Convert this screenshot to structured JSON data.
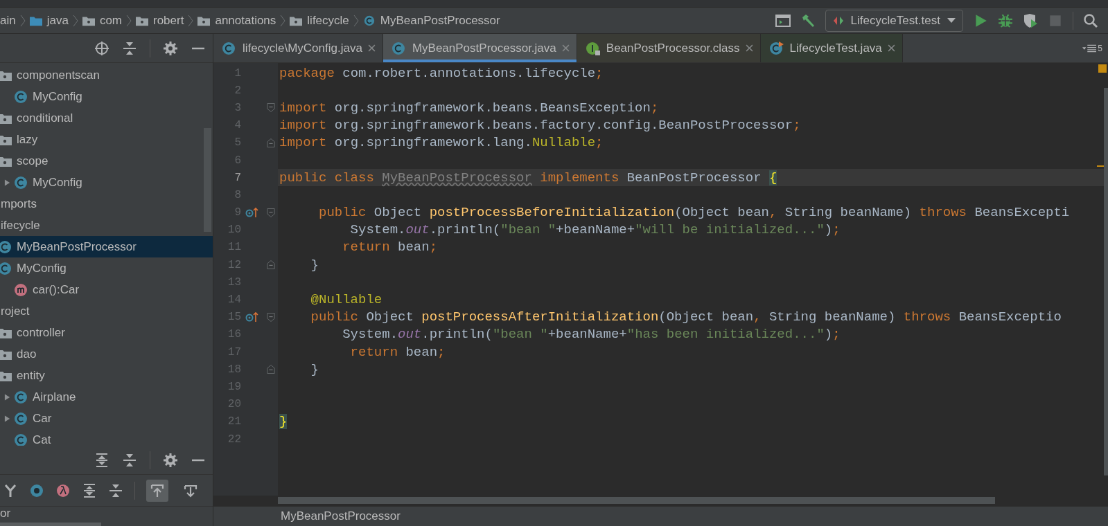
{
  "breadcrumbs": [
    {
      "kind": "none",
      "label": "ain"
    },
    {
      "kind": "source",
      "label": "java"
    },
    {
      "kind": "package",
      "label": "com"
    },
    {
      "kind": "package",
      "label": "robert"
    },
    {
      "kind": "package",
      "label": "annotations"
    },
    {
      "kind": "package",
      "label": "lifecycle"
    },
    {
      "kind": "class",
      "label": "MyBeanPostProcessor"
    }
  ],
  "run_config": {
    "label": "LifecycleTest.test"
  },
  "sidebar": {
    "tree_tail": [
      {
        "kind": "package",
        "label": "componentscan",
        "selected": false,
        "children": [
          {
            "kind": "class",
            "label": "MyConfig",
            "selected": false
          }
        ]
      },
      {
        "kind": "package",
        "label": "conditional",
        "selected": false
      },
      {
        "kind": "package",
        "label": "lazy",
        "selected": false
      },
      {
        "kind": "package",
        "label": "scope",
        "selected": false,
        "children": [
          {
            "kind": "class",
            "label": "MyConfig",
            "selected": false,
            "expanded": false
          }
        ]
      }
    ],
    "tree": [
      {
        "label": "mports",
        "selected": false
      },
      {
        "label": "ifecycle",
        "selected": false,
        "children": [
          {
            "kind": "class",
            "label": "MyBeanPostProcessor",
            "selected": true
          },
          {
            "kind": "class",
            "label": "MyConfig",
            "selected": false,
            "children": [
              {
                "kind": "method",
                "label": "car():Car",
                "selected": false
              }
            ]
          }
        ]
      },
      {
        "label": "roject",
        "selected": false,
        "children": [
          {
            "kind": "package",
            "label": "controller",
            "selected": false
          },
          {
            "kind": "package",
            "label": "dao",
            "selected": false
          },
          {
            "kind": "package",
            "label": "entity",
            "selected": false,
            "children": [
              {
                "kind": "class",
                "label": "Airplane",
                "selected": false,
                "expanded": false
              },
              {
                "kind": "class",
                "label": "Car",
                "selected": false,
                "expanded": false
              },
              {
                "kind": "class",
                "label": "Cat",
                "selected": false
              }
            ]
          }
        ]
      }
    ],
    "toggles": [
      {
        "selected": true
      },
      {
        "selected": false
      }
    ],
    "footer": "or"
  },
  "tabs": [
    {
      "kind": "class",
      "label": "lifecycle\\MyConfig.java",
      "selected": false
    },
    {
      "kind": "class",
      "label": "MyBeanPostProcessor.java",
      "selected": true
    },
    {
      "kind": "interface",
      "label": "BeanPostProcessor.class",
      "selected": false
    },
    {
      "kind": "test",
      "label": "LifecycleTest.java",
      "selected": false
    }
  ],
  "tab_count": "5",
  "editor": {
    "lines": [
      {
        "number": "1",
        "tokens": [
          {
            "kind": "kw",
            "text": "package"
          },
          {
            "kind": "plain",
            "text": " com.robert.annotations.lifecycle"
          },
          {
            "kind": "kw",
            "text": ";"
          }
        ]
      },
      {
        "number": "2"
      },
      {
        "number": "3",
        "fold_open": true,
        "tokens": [
          {
            "kind": "kw",
            "text": "import"
          },
          {
            "kind": "plain",
            "text": " org.springframework.beans.BeansException"
          },
          {
            "kind": "kw",
            "text": ";"
          }
        ]
      },
      {
        "number": "4",
        "tokens": [
          {
            "kind": "kw",
            "text": "import"
          },
          {
            "kind": "plain",
            "text": " org.springframework.beans.factory.config.BeanPostProcessor"
          },
          {
            "kind": "kw",
            "text": ";"
          }
        ]
      },
      {
        "number": "5",
        "fold_close": true,
        "tokens": [
          {
            "kind": "kw",
            "text": "import"
          },
          {
            "kind": "plain",
            "text": " org.springframework.lang."
          },
          {
            "kind": "ann",
            "text": "Nullable"
          },
          {
            "kind": "kw",
            "text": ";"
          }
        ]
      },
      {
        "number": "6"
      },
      {
        "number": "7",
        "current": true,
        "tokens": [
          {
            "kind": "kw",
            "text": "public class "
          },
          {
            "kind": "unused",
            "text": "MyBeanPostProcessor"
          },
          {
            "kind": "kw",
            "text": " implements "
          },
          {
            "kind": "plain",
            "text": "BeanPostProcessor "
          },
          {
            "kind": "match",
            "text": "{"
          }
        ]
      },
      {
        "number": "8"
      },
      {
        "number": "9",
        "fold_open": true,
        "overrides": true,
        "tokens": [
          {
            "kind": "kw",
            "text": "     public "
          },
          {
            "kind": "plain",
            "text": "Object "
          },
          {
            "kind": "fn",
            "text": "postProcessBeforeInitialization"
          },
          {
            "kind": "plain",
            "text": "(Object bean"
          },
          {
            "kind": "kw",
            "text": ", "
          },
          {
            "kind": "plain",
            "text": "String beanName) "
          },
          {
            "kind": "kw",
            "text": "throws "
          },
          {
            "kind": "plain",
            "text": "BeansExcepti"
          }
        ]
      },
      {
        "number": "10",
        "tokens": [
          {
            "kind": "plain",
            "text": "         System."
          },
          {
            "kind": "field",
            "text": "out"
          },
          {
            "kind": "plain",
            "text": ".println("
          },
          {
            "kind": "str",
            "text": "\"bean \""
          },
          {
            "kind": "plain",
            "text": "+beanName+"
          },
          {
            "kind": "str",
            "text": "\"will be initialized...\""
          },
          {
            "kind": "plain",
            "text": ")"
          },
          {
            "kind": "kw",
            "text": ";"
          }
        ]
      },
      {
        "number": "11",
        "tokens": [
          {
            "kind": "kw",
            "text": "        return "
          },
          {
            "kind": "plain",
            "text": "bean"
          },
          {
            "kind": "kw",
            "text": ";"
          }
        ]
      },
      {
        "number": "12",
        "fold_close": true,
        "tokens": [
          {
            "kind": "plain",
            "text": "    }"
          }
        ]
      },
      {
        "number": "13"
      },
      {
        "number": "14",
        "tokens": [
          {
            "kind": "ann",
            "text": "    @Nullable"
          }
        ]
      },
      {
        "number": "15",
        "fold_open": true,
        "overrides": true,
        "tokens": [
          {
            "kind": "kw",
            "text": "    public "
          },
          {
            "kind": "plain",
            "text": "Object "
          },
          {
            "kind": "fn",
            "text": "postProcessAfterInitialization"
          },
          {
            "kind": "plain",
            "text": "(Object bean"
          },
          {
            "kind": "kw",
            "text": ", "
          },
          {
            "kind": "plain",
            "text": "String beanName) "
          },
          {
            "kind": "kw",
            "text": "throws "
          },
          {
            "kind": "plain",
            "text": "BeansExceptio"
          }
        ]
      },
      {
        "number": "16",
        "tokens": [
          {
            "kind": "plain",
            "text": "        System."
          },
          {
            "kind": "field",
            "text": "out"
          },
          {
            "kind": "plain",
            "text": ".println("
          },
          {
            "kind": "str",
            "text": "\"bean \""
          },
          {
            "kind": "plain",
            "text": "+beanName+"
          },
          {
            "kind": "str",
            "text": "\"has been initialized...\""
          },
          {
            "kind": "plain",
            "text": ")"
          },
          {
            "kind": "kw",
            "text": ";"
          }
        ]
      },
      {
        "number": "17",
        "tokens": [
          {
            "kind": "kw",
            "text": "         return "
          },
          {
            "kind": "plain",
            "text": "bean"
          },
          {
            "kind": "kw",
            "text": ";"
          }
        ]
      },
      {
        "number": "18",
        "fold_close": true,
        "tokens": [
          {
            "kind": "plain",
            "text": "    }"
          }
        ]
      },
      {
        "number": "19"
      },
      {
        "number": "20"
      },
      {
        "number": "21",
        "tokens": [
          {
            "kind": "match",
            "text": "}"
          }
        ]
      },
      {
        "number": "22"
      }
    ]
  },
  "status_bar": {
    "text": "MyBeanPostProcessor"
  }
}
